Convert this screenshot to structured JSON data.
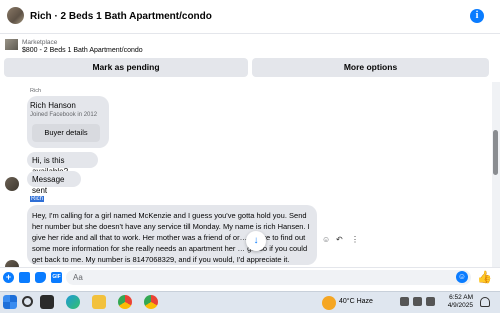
{
  "header": {
    "title": "Rich · 2 Beds 1 Bath Apartment/condo",
    "info_icon": "info-icon"
  },
  "marketplace": {
    "label": "Marketplace",
    "item": "$800 - 2 Beds 1 Bath Apartment/condo",
    "pending_button": "Mark as pending",
    "more_button": "More options"
  },
  "chat": {
    "sender_label": "Rich",
    "profile_card": {
      "name": "Rich Hanson",
      "joined": "Joined Facebook in 2012",
      "button": "Buyer details"
    },
    "messages": [
      {
        "text": "Hi, is this available?"
      },
      {
        "text": "Message sent"
      },
      {
        "sender": "Rich",
        "text": "Hey, I'm calling for a girl named McKenzie and I guess you've gotta hold you. Send her number but she doesn't have any service till Monday. My name is rich Hansen. I give her ride and all that to work. Her mother was a friend of or… I'd like to find out some more information for she really needs an apartment her … girl so if you could get back to me. My number is 8147068329, and if you would, I'd appreciate it."
      }
    ]
  },
  "composer": {
    "placeholder": "Aa"
  },
  "taskbar": {
    "weather": "40°C  Haze",
    "time": "6:52 AM",
    "date": "4/9/2025"
  },
  "colors": {
    "accent": "#0a7cff",
    "bubble": "#e4e6eb"
  }
}
